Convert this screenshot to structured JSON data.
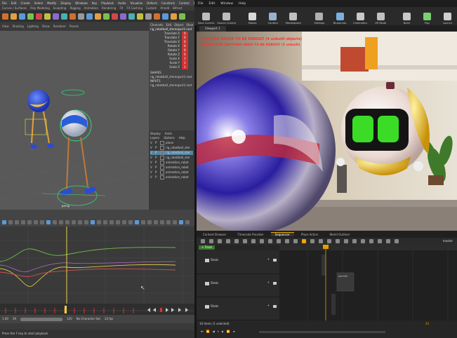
{
  "maya": {
    "menu": [
      "File",
      "Edit",
      "Create",
      "Select",
      "Modify",
      "Display",
      "Windows",
      "Key",
      "Playback",
      "Audio",
      "Visualize",
      "Deform",
      "Constrain",
      "Control",
      "Cache"
    ],
    "shelf_tabs": [
      "Curves / Surfaces",
      "Poly Modeling",
      "Sculpting",
      "Rigging",
      "Animation",
      "Rendering",
      "FX",
      "FX Caching",
      "Custom",
      "Arnold",
      "Bifrost"
    ],
    "panel_tabs": [
      "View",
      "Shading",
      "Lighting",
      "Show",
      "Renderer",
      "Panels"
    ],
    "viewport_label": "persp",
    "channel_box": {
      "header": [
        "Channels",
        "Edit",
        "Object",
        "Show"
      ],
      "object": "rig_robotball_stereopair1:root",
      "attrs": [
        {
          "name": "Translate X",
          "value": "0"
        },
        {
          "name": "Translate Y",
          "value": "0"
        },
        {
          "name": "Translate Z",
          "value": "0"
        },
        {
          "name": "Rotate X",
          "value": "0"
        },
        {
          "name": "Rotate Y",
          "value": "0"
        },
        {
          "name": "Rotate Z",
          "value": "0"
        },
        {
          "name": "Scale X",
          "value": "1"
        },
        {
          "name": "Scale Y",
          "value": "1"
        },
        {
          "name": "Scale Z",
          "value": "1"
        }
      ],
      "shapes_label": "SHAPES",
      "shape": "rig_robotball_stereopair1:root",
      "inputs_label": "INPUTS",
      "input": "rig_robotball_stereopair1:root"
    },
    "outliner": {
      "tabs": [
        "Display",
        "Anim"
      ],
      "menu": [
        "Layers",
        "Options",
        "Help"
      ],
      "rows": [
        "plane",
        "rig_robotball_ster",
        "rig_robotball_ster",
        "rig_robotball_ster",
        "animation_robot",
        "animation_robot",
        "animation_robot",
        "animation_robot"
      ]
    },
    "helpline": "Press the F key to start playback",
    "time": {
      "start": "1.00",
      "end": "120",
      "current": "39",
      "anim_layer": "No Character Set",
      "fps": "24 fps"
    }
  },
  "unreal": {
    "menu": [
      "File",
      "Edit",
      "Window",
      "Help"
    ],
    "toolbar": [
      "Save Current",
      "Source Control",
      "Modes",
      "Content",
      "Marketplace",
      "Settings",
      "Blueprints",
      "Cinematics",
      "VR Mode",
      "Build",
      "Play",
      "Launch"
    ],
    "viewport_tab": "Viewport 1",
    "warning": "LIGHTING NEEDS TO BE REBUILT (4 unbuilt objects)",
    "warning2": "REFLECTION CAPTURES NEED TO BE REBUILT (5 unbuilt)",
    "seq_tabs": [
      "Content Browser",
      "Timecode Provider",
      "Sequencer",
      "Place Actors",
      "World Outliner"
    ],
    "track_filter": "+ Track",
    "tracks": [
      {
        "label": "Shots"
      },
      {
        "label": "Shots"
      },
      {
        "label": "Shots"
      }
    ],
    "clip_label": "anim02",
    "frame_count": "34",
    "items_label": "10 items (1 selected)",
    "master_label": "master"
  },
  "colors": {
    "ue_accent": "#f1a800",
    "maya_key": "#d33",
    "curve_green": "#6fbf4c",
    "curve_red": "#d45050",
    "curve_yellow": "#d8c44a",
    "selected_row": "#5285a6"
  }
}
